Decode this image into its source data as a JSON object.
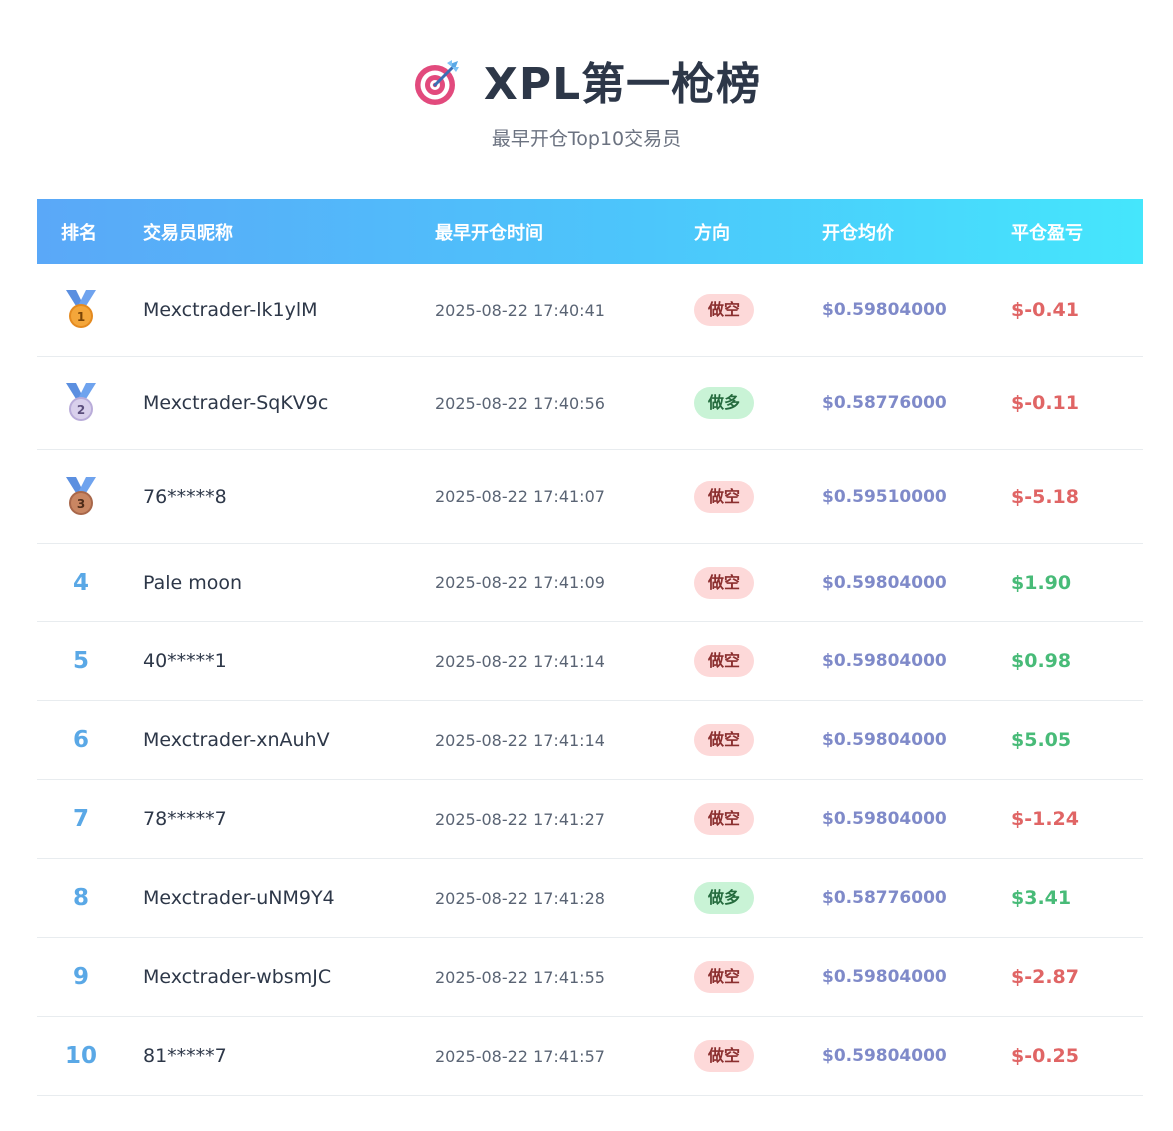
{
  "header": {
    "target_icon": "target-dart-icon",
    "title": "XPL第一枪榜",
    "subtitle": "最早开仓Top10交易员"
  },
  "table": {
    "columns": [
      "排名",
      "交易员昵称",
      "最早开仓时间",
      "方向",
      "开仓均价",
      "平仓盈亏"
    ],
    "rows": [
      {
        "rank": "1",
        "medal": "gold-medal-icon",
        "name": "Mexctrader-lk1ylM",
        "time": "2025-08-22 17:40:41",
        "direction": "做空",
        "dir_type": "short",
        "price": "$0.59804000",
        "pnl": "$-0.41",
        "pnl_type": "neg"
      },
      {
        "rank": "2",
        "medal": "silver-medal-icon",
        "name": "Mexctrader-SqKV9c",
        "time": "2025-08-22 17:40:56",
        "direction": "做多",
        "dir_type": "long",
        "price": "$0.58776000",
        "pnl": "$-0.11",
        "pnl_type": "neg"
      },
      {
        "rank": "3",
        "medal": "bronze-medal-icon",
        "name": "76*****8",
        "time": "2025-08-22 17:41:07",
        "direction": "做空",
        "dir_type": "short",
        "price": "$0.59510000",
        "pnl": "$-5.18",
        "pnl_type": "neg"
      },
      {
        "rank": "4",
        "name": "Pale moon",
        "time": "2025-08-22 17:41:09",
        "direction": "做空",
        "dir_type": "short",
        "price": "$0.59804000",
        "pnl": "$1.90",
        "pnl_type": "pos"
      },
      {
        "rank": "5",
        "name": "40*****1",
        "time": "2025-08-22 17:41:14",
        "direction": "做空",
        "dir_type": "short",
        "price": "$0.59804000",
        "pnl": "$0.98",
        "pnl_type": "pos"
      },
      {
        "rank": "6",
        "name": "Mexctrader-xnAuhV",
        "time": "2025-08-22 17:41:14",
        "direction": "做空",
        "dir_type": "short",
        "price": "$0.59804000",
        "pnl": "$5.05",
        "pnl_type": "pos"
      },
      {
        "rank": "7",
        "name": "78*****7",
        "time": "2025-08-22 17:41:27",
        "direction": "做空",
        "dir_type": "short",
        "price": "$0.59804000",
        "pnl": "$-1.24",
        "pnl_type": "neg"
      },
      {
        "rank": "8",
        "name": "Mexctrader-uNM9Y4",
        "time": "2025-08-22 17:41:28",
        "direction": "做多",
        "dir_type": "long",
        "price": "$0.58776000",
        "pnl": "$3.41",
        "pnl_type": "pos"
      },
      {
        "rank": "9",
        "name": "Mexctrader-wbsmJC",
        "time": "2025-08-22 17:41:55",
        "direction": "做空",
        "dir_type": "short",
        "price": "$0.59804000",
        "pnl": "$-2.87",
        "pnl_type": "neg"
      },
      {
        "rank": "10",
        "name": "81*****7",
        "time": "2025-08-22 17:41:57",
        "direction": "做空",
        "dir_type": "short",
        "price": "$0.59804000",
        "pnl": "$-0.25",
        "pnl_type": "neg"
      }
    ]
  },
  "colors": {
    "header_gradient_start": "#5aa8f8",
    "header_gradient_end": "#45e6fc",
    "rank_number": "#5aa8e6",
    "price": "#7f8ac9",
    "pnl_negative": "#e06565",
    "pnl_positive": "#48bb78",
    "badge_short_bg": "#fdd9d9",
    "badge_long_bg": "#c9f3d6"
  }
}
